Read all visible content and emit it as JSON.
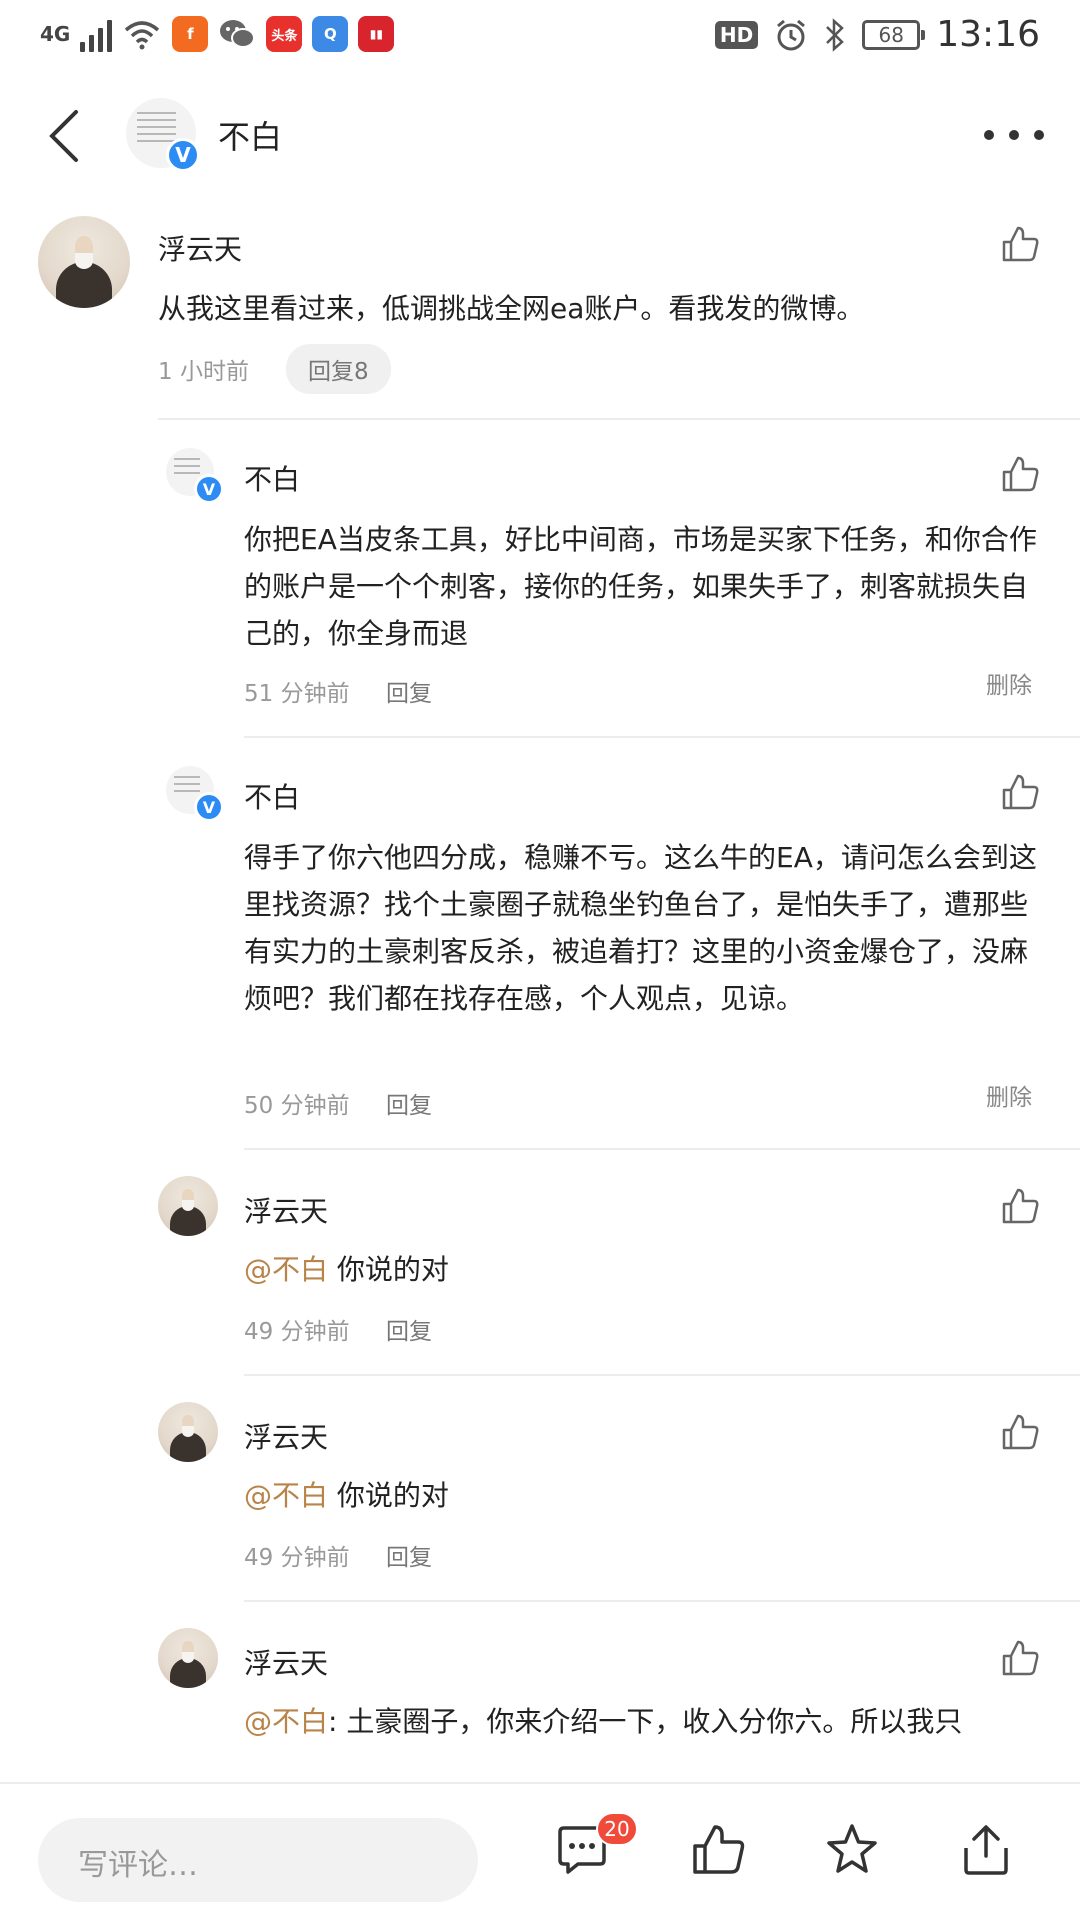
{
  "status_bar": {
    "network": "4G",
    "hd": "HD",
    "battery": "68",
    "time": "13:16",
    "icons": [
      "signal-icon",
      "wifi-icon",
      "app-icon-orange",
      "wechat-icon",
      "toutiao-icon",
      "browser-icon",
      "news-icon",
      "alarm-icon",
      "bluetooth-icon"
    ]
  },
  "header": {
    "title": "不白"
  },
  "comments": [
    {
      "name": "浮云天",
      "text": "从我这里看过来，低调挑战全网ea账户。看我发的微博。",
      "time": "1 小时前",
      "reply": "回复8"
    },
    {
      "name": "不白",
      "text": "你把EA当皮条工具，好比中间商，市场是买家下任务，和你合作的账户是一个个刺客，接你的任务，如果失手了，刺客就损失自己的，你全身而退",
      "time": "51 分钟前",
      "reply": "回复",
      "delete": "删除"
    },
    {
      "name": "不白",
      "text": "得手了你六他四分成，稳赚不亏。这么牛的EA，请问怎么会到这里找资源？找个土豪圈子就稳坐钓鱼台了，是怕失手了，遭那些有实力的土豪刺客反杀，被追着打？这里的小资金爆仓了，没麻烦吧？我们都在找存在感，个人观点，见谅。",
      "time": "50 分钟前",
      "reply": "回复",
      "delete": "删除"
    },
    {
      "name": "浮云天",
      "mention": "@不白",
      "text": " 你说的对",
      "time": "49 分钟前",
      "reply": "回复"
    },
    {
      "name": "浮云天",
      "mention": "@不白",
      "text": " 你说的对",
      "time": "49 分钟前",
      "reply": "回复"
    },
    {
      "name": "浮云天",
      "mention": "@不白",
      "text": ": 土豪圈子，你来介绍一下，收入分你六。所以我只"
    }
  ],
  "bottom_bar": {
    "placeholder": "写评论…",
    "comment_count": "20"
  },
  "colors": {
    "mention": "#b8844a",
    "badge": "#f04a3a",
    "verified": "#2c8cf4"
  }
}
